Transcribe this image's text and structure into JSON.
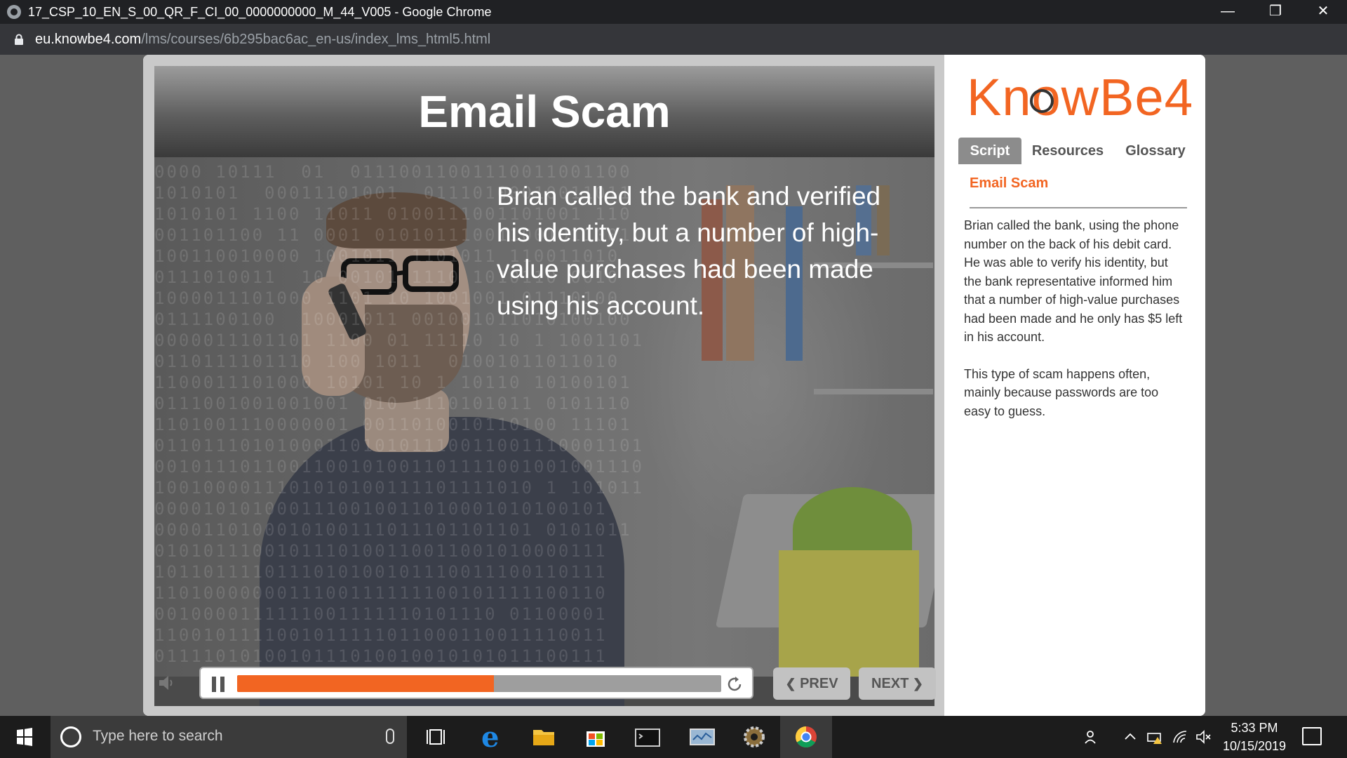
{
  "browser": {
    "window_title": "17_CSP_10_EN_S_00_QR_F_CI_00_0000000000_M_44_V005 - Google Chrome",
    "url_host": "eu.knowbe4.com",
    "url_path": "/lms/courses/6b295bac6ac_en-us/index_lms_html5.html",
    "controls": {
      "minimize": "—",
      "restore": "❐",
      "close": "✕"
    }
  },
  "slide": {
    "title": "Email Scam",
    "text": "Brian called the bank and verified his identity, but a number of high-value purchases had been made using his account.",
    "binary_rows": [
      "0000 10111  01  01110011001110011001100",
      "1010101  00011101001  01110100010011011",
      "1010101 1100 11011 0100111001101001 110",
      "001101100 11 0001 010101110011001011001",
      "100110010000 1001011 1101011 110011010",
      "0111010011  10 00101 1110 1010110 0010",
      "1000011101000 1101 10 1001001 01110100",
      "0111100100  10001011 001001011010100100",
      "0000011101101 1100 01 11110 10 1 1001101",
      "0110111101110 100 1011  01001011011010",
      "1100011101000 10101 10 1 10110 10100101",
      "0111001001001001 010 1110101011 0101110",
      "1101001110000001 0011010010110100 11101",
      "0110111010100011010101110011001110001101",
      "0010111011001100101001101111001001001110",
      "1001000011101010100111101111010 1 101011",
      "0000101010001110010011010001010100101",
      "0000110100010100111011101101101 0101011",
      "0101011100101110100110011001010000111",
      "1011011110111010100101110011100110111",
      "1101000000011100111111100101111100110",
      "0010000111111001111110101110 01100001",
      "1100101111001011111011000110011110011",
      "0111101010010111010010010101011100111"
    ]
  },
  "player": {
    "progress_percent": 53,
    "prev_label": "PREV",
    "next_label": "NEXT",
    "prev_chevron": "❮",
    "next_chevron": "❯"
  },
  "sidebar": {
    "brand": "KnowBe4",
    "tabs": [
      "Script",
      "Resources",
      "Glossary"
    ],
    "active_tab": "Script",
    "heading": "Email Scam",
    "paragraphs": [
      "Brian called the bank, using the phone number on the back of his debit card. He was able to verify his identity, but the bank representative informed him that a number of high-value purchases had been made and he only has $5 left in his account.",
      "This type of scam happens often, mainly because passwords are too easy to guess."
    ]
  },
  "taskbar": {
    "search_placeholder": "Type here to search",
    "time": "5:33 PM",
    "date": "10/15/2019",
    "apps": [
      "task-view",
      "edge",
      "file-explorer",
      "microsoft-store",
      "terminal",
      "control-panel",
      "settings",
      "chrome"
    ]
  },
  "colors": {
    "accent": "#f26522",
    "chrome_dark": "#202124",
    "addressbar": "#35363a",
    "taskbar": "#1c1c1c"
  }
}
